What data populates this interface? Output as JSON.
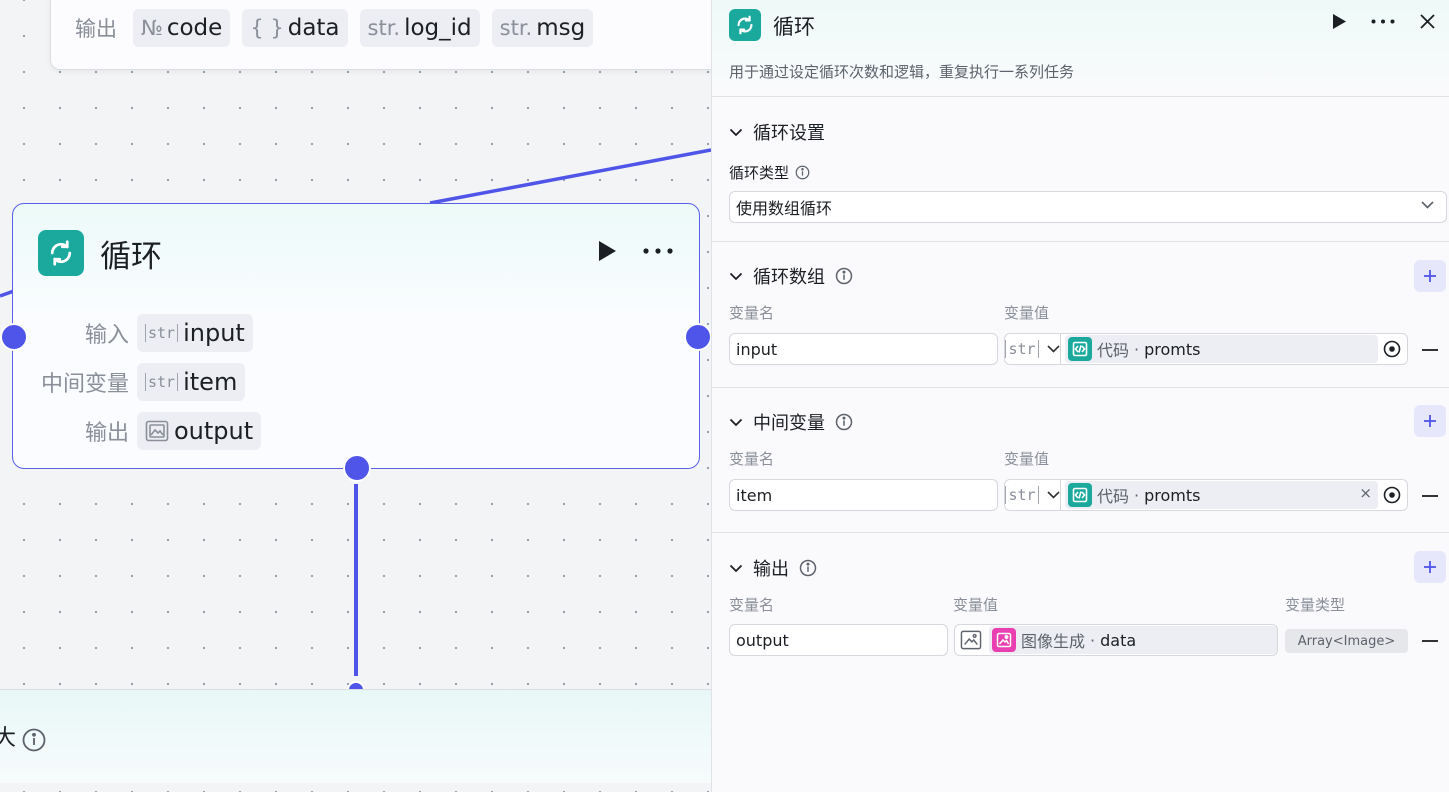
{
  "canvas": {
    "top_card": {
      "label": "输出",
      "outputs": [
        {
          "type": "№",
          "name": "code"
        },
        {
          "type": "{ }",
          "name": "data"
        },
        {
          "type": "str.",
          "name": "log_id"
        },
        {
          "type": "str.",
          "name": "msg"
        }
      ]
    },
    "loop_node": {
      "title": "循环",
      "rows": [
        {
          "label": "输入",
          "type": "str",
          "name": "input"
        },
        {
          "label": "中间变量",
          "type": "str",
          "name": "item"
        },
        {
          "label": "输出",
          "type": "img",
          "name": "output"
        }
      ]
    },
    "bottom_card": {
      "title_fragment": "大"
    }
  },
  "panel": {
    "title": "循环",
    "description": "用于通过设定循环次数和逻辑，重复执行一系列任务",
    "loop_settings": {
      "title": "循环设置",
      "type_label": "循环类型",
      "type_value": "使用数组循环"
    },
    "loop_array": {
      "title": "循环数组",
      "col_name": "变量名",
      "col_value": "变量值",
      "row": {
        "name": "input",
        "type_tag": "str",
        "ref_source": "代码",
        "ref_field": "promts"
      }
    },
    "intermediate": {
      "title": "中间变量",
      "col_name": "变量名",
      "col_value": "变量值",
      "row": {
        "name": "item",
        "type_tag": "str",
        "ref_source": "代码",
        "ref_field": "promts",
        "clear": "×"
      }
    },
    "outputs": {
      "title": "输出",
      "col_name": "变量名",
      "col_value": "变量值",
      "col_type": "变量类型",
      "row": {
        "name": "output",
        "ref_source": "图像生成",
        "ref_field": "data",
        "var_type": "Array<Image>"
      }
    },
    "separator": " · "
  },
  "colors": {
    "accent": "#4f55e8",
    "teal": "#1ba99d",
    "pink": "#e93fb0"
  }
}
